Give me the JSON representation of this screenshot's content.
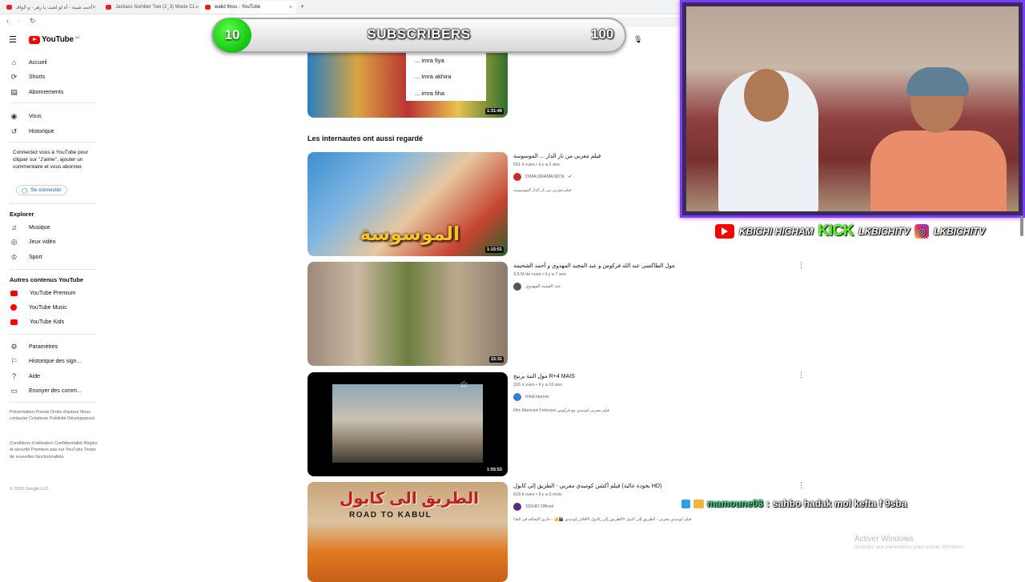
{
  "browser": {
    "tabs": [
      {
        "title": "أحمد شيبة - أه لو لعبت يا زهر - و الواقـ"
      },
      {
        "title": "Jackass Number Two (2_3) Movie CL"
      },
      {
        "title": "walid frkos - YouTube"
      }
    ],
    "url": "youtube.com/results?search_query=walid+frkos",
    "new_tab": "+",
    "close": "×"
  },
  "youtube": {
    "logo_text": "YouTube",
    "logo_suffix": "MA",
    "sidebar": {
      "main": [
        {
          "label": "Accueil",
          "icon": "⌂"
        },
        {
          "label": "Shorts",
          "icon": "⟳"
        },
        {
          "label": "Abonnements",
          "icon": "▤"
        }
      ],
      "you": [
        {
          "label": "Vous",
          "icon": "◉"
        },
        {
          "label": "Historique",
          "icon": "↺"
        }
      ],
      "signin_text": "Connectez vous à YouTube pour cliquer sur \"J'aime\", ajouter un commentaire et vous abonner.",
      "signin_button": "Se connecter",
      "explore_title": "Explorer",
      "explore": [
        {
          "label": "Musique",
          "icon": "♫"
        },
        {
          "label": "Jeux vidéo",
          "icon": "◎"
        },
        {
          "label": "Sport",
          "icon": "♔"
        }
      ],
      "more_title": "Autres contenus YouTube",
      "more": [
        {
          "label": "YouTube Premium"
        },
        {
          "label": "YouTube Music"
        },
        {
          "label": "YouTube Kids"
        }
      ],
      "settings": [
        {
          "label": "Paramètres",
          "icon": "⚙"
        },
        {
          "label": "Historique des sign...",
          "icon": "⚐"
        },
        {
          "label": "Aide",
          "icon": "?"
        },
        {
          "label": "Envoyer des comm...",
          "icon": "▭"
        }
      ],
      "footer1": "Présentation  Presse  Droits d'auteur  Nous contacter  Créateurs  Publicité  Développeurs",
      "footer2": "Conditions d'utilisation  Confidentialité  Règles et sécurité  Premiers pas sur YouTube  Tester de nouvelles fonctionnalités",
      "copyright": "© 2025 Google LLC"
    },
    "dropdown": [
      "... imra fiya",
      "... imra akhira",
      "... imra fiha"
    ],
    "top_thumb_duration": "1:31:49",
    "section_title": "Les internautes ont aussi regardé",
    "videos": [
      {
        "title": "فيلم مغربي من نار الدار ... الموسوسة",
        "meta": "551 k vues • il y a 2 ans",
        "channel": "DIMA DRAMA MCN",
        "verified": "✔",
        "desc": "فيلم مغربي من نار الدار الموسوسة",
        "duration": "1:15:51",
        "accent": "#cc2b2b"
      },
      {
        "title": "مول الطاكسي عبد الله فركوس و عبد المجيد المهدوي و أحمد الشحيمة",
        "meta": "3,5 M de vues • il y a 7 ans",
        "channel": "عبد المجيد المهدوي",
        "verified": "",
        "desc": "",
        "duration": "15:31",
        "accent": "#555555"
      },
      {
        "title": "مول النية برنيج R+4 MAIS",
        "meta": "226 k vues • il y a 10 ans",
        "channel": "InfoExtumer",
        "verified": "",
        "desc": "Film Marocain Ferkouss فيلم مغربي كوميدي مع فركوس",
        "duration": "1:55:53",
        "accent": "#3a7bd5"
      },
      {
        "title": "فيلم أكشن كوميدي مغربي - الطريق إلى كابول (بجودة عالية HD)",
        "meta": "618 k vues • il y a 3 mois",
        "channel": "SDURI Officiel",
        "verified": "",
        "desc": "فيلم كوميدي مغربي - الطريق إلى كابول #الطريق_إلى_كابول #أفلام_كوميدي 🎬👍 - جاري الإضافة في القاء",
        "duration": "",
        "accent": "#5a2d82"
      }
    ],
    "thumb_texts": {
      "v1": "الموسوسة",
      "v4_ar": "الطريق الى كابول",
      "v4_en": "ROAD TO KABUL"
    },
    "kebab": "⋮"
  },
  "overlay": {
    "subs_current": "10",
    "subs_label": "SUBSCRIBERS",
    "subs_goal": "100",
    "subs_progress": 0.1,
    "social": {
      "youtube": "KBICHI HICHAM",
      "kick_logo": "KICK",
      "kick": "LKBICHITV",
      "instagram": "LKBICHITV"
    },
    "chat": {
      "user": "mamoune03",
      "sep": ":",
      "message": "sahbo hadak mol kefta f 9sba"
    }
  },
  "windows": {
    "activate_title": "Activer Windows",
    "activate_sub": "Accédez aux paramètres pour activer Windows."
  }
}
